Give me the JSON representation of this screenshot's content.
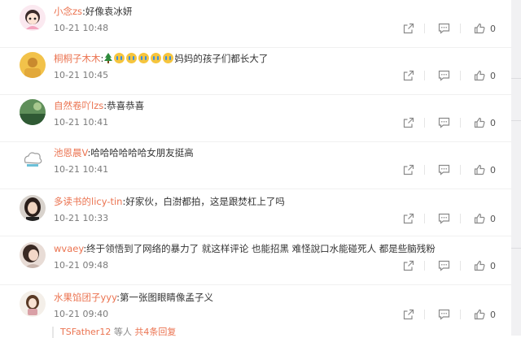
{
  "comments": [
    {
      "username": "小念zs",
      "text": ":好像袁冰妍",
      "time": "10-21 10:48",
      "likes": "0",
      "avatar": "girl-cartoon"
    },
    {
      "username": "桐桐子木木",
      "text_before": ":",
      "text_after": "妈妈的孩子们都长大了",
      "emojis": [
        "tree-emoji",
        "crying-emoji",
        "crying-emoji",
        "crying-emoji",
        "crying-emoji",
        "crying-emoji"
      ],
      "time": "10-21 10:45",
      "likes": "0",
      "avatar": "yellow-photo"
    },
    {
      "username": "自然卷吖lzs",
      "text": ":恭喜恭喜",
      "time": "10-21 10:41",
      "likes": "0",
      "avatar": "green-photo"
    },
    {
      "username": "池恩晨V",
      "text": ":哈哈哈哈哈哈女朋友挺高",
      "time": "10-21 10:41",
      "likes": "0",
      "avatar": "default-cloud"
    },
    {
      "username": "多读书的licy-tin",
      "text": ":好家伙，白澍都拍，这是跟焚杠上了吗",
      "time": "10-21 10:33",
      "likes": "0",
      "avatar": "girl-photo"
    },
    {
      "username": "wvaey",
      "text": ":终于领悟到了网络的暴力了 就这样评论 也能招黑 难怪說口水能碰死人 都是些脑残粉",
      "time": "10-21 09:48",
      "likes": "0",
      "avatar": "woman-photo"
    },
    {
      "username": "水果馅团子yyy",
      "text": ":第一张图眼睛像孟子义",
      "time": "10-21 09:40",
      "likes": "0",
      "avatar": "doll-photo"
    }
  ],
  "more_replies": {
    "user": "TSFather12",
    "mid": "等人",
    "count_text": "共4条回复"
  },
  "icons": {
    "share": "share-icon",
    "reply": "comment-icon",
    "like": "thumbs-up-icon"
  },
  "colors": {
    "username": "#eb7350",
    "text": "#333333",
    "time": "#7a7a7a",
    "icon": "#8a8a8a"
  }
}
